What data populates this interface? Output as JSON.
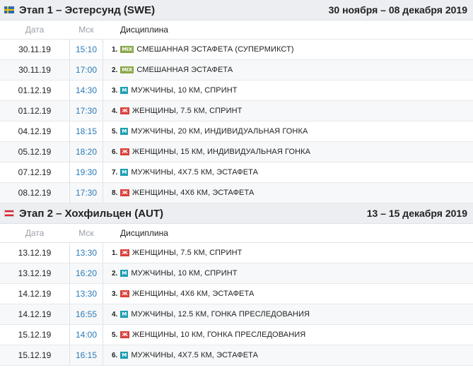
{
  "stages": [
    {
      "flag": "swe",
      "title": "Этап 1 – Эстерсунд (SWE)",
      "dates": "30 ноября – 08 декабря 2019",
      "columns": {
        "date": "Дата",
        "time": "Мск",
        "discipline": "Дисциплина"
      },
      "rows": [
        {
          "date": "30.11.19",
          "time": "15:10",
          "num": "1.",
          "badge": "MIX",
          "badge_type": "mix",
          "name": "СМЕШАННАЯ ЭСТАФЕТА (СУПЕРМИКСТ)"
        },
        {
          "date": "30.11.19",
          "time": "17:00",
          "num": "2.",
          "badge": "MIX",
          "badge_type": "mix",
          "name": "СМЕШАННАЯ ЭСТАФЕТА"
        },
        {
          "date": "01.12.19",
          "time": "14:30",
          "num": "3.",
          "badge": "М",
          "badge_type": "m",
          "name": "МУЖЧИНЫ, 10 КМ, СПРИНТ"
        },
        {
          "date": "01.12.19",
          "time": "17:30",
          "num": "4.",
          "badge": "Ж",
          "badge_type": "w",
          "name": "ЖЕНЩИНЫ, 7.5 КМ, СПРИНТ"
        },
        {
          "date": "04.12.19",
          "time": "18:15",
          "num": "5.",
          "badge": "М",
          "badge_type": "m",
          "name": "МУЖЧИНЫ, 20 КМ, ИНДИВИДУАЛЬНАЯ ГОНКА"
        },
        {
          "date": "05.12.19",
          "time": "18:20",
          "num": "6.",
          "badge": "Ж",
          "badge_type": "w",
          "name": "ЖЕНЩИНЫ, 15 КМ, ИНДИВИДУАЛЬНАЯ ГОНКА"
        },
        {
          "date": "07.12.19",
          "time": "19:30",
          "num": "7.",
          "badge": "М",
          "badge_type": "m",
          "name": "МУЖЧИНЫ, 4Х7.5 КМ, ЭСТАФЕТА"
        },
        {
          "date": "08.12.19",
          "time": "17:30",
          "num": "8.",
          "badge": "Ж",
          "badge_type": "w",
          "name": "ЖЕНЩИНЫ, 4Х6 КМ, ЭСТАФЕТА"
        }
      ]
    },
    {
      "flag": "aut",
      "title": "Этап 2 – Хохфильцен (AUT)",
      "dates": "13 – 15 декабря 2019",
      "columns": {
        "date": "Дата",
        "time": "Мск",
        "discipline": "Дисциплина"
      },
      "rows": [
        {
          "date": "13.12.19",
          "time": "13:30",
          "num": "1.",
          "badge": "Ж",
          "badge_type": "w",
          "name": "ЖЕНЩИНЫ, 7.5 КМ, СПРИНТ"
        },
        {
          "date": "13.12.19",
          "time": "16:20",
          "num": "2.",
          "badge": "М",
          "badge_type": "m",
          "name": "МУЖЧИНЫ, 10 КМ, СПРИНТ"
        },
        {
          "date": "14.12.19",
          "time": "13:30",
          "num": "3.",
          "badge": "Ж",
          "badge_type": "w",
          "name": "ЖЕНЩИНЫ, 4Х6 КМ, ЭСТАФЕТА"
        },
        {
          "date": "14.12.19",
          "time": "16:55",
          "num": "4.",
          "badge": "М",
          "badge_type": "m",
          "name": "МУЖЧИНЫ, 12.5 КМ, ГОНКА ПРЕСЛЕДОВАНИЯ"
        },
        {
          "date": "15.12.19",
          "time": "14:00",
          "num": "5.",
          "badge": "Ж",
          "badge_type": "w",
          "name": "ЖЕНЩИНЫ, 10 КМ, ГОНКА ПРЕСЛЕДОВАНИЯ"
        },
        {
          "date": "15.12.19",
          "time": "16:15",
          "num": "6.",
          "badge": "М",
          "badge_type": "m",
          "name": "МУЖЧИНЫ, 4Х7.5 КМ, ЭСТАФЕТА"
        }
      ]
    }
  ]
}
